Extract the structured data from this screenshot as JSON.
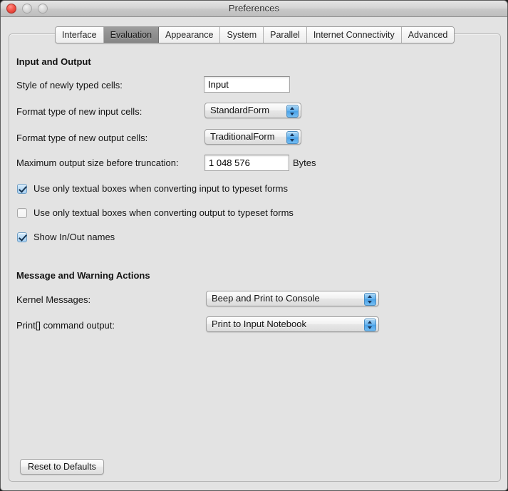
{
  "window": {
    "title": "Preferences",
    "traffic_lights": [
      {
        "name": "close-button",
        "color": "#f4554a"
      },
      {
        "name": "minimize-button",
        "color": "#d8d8d8"
      },
      {
        "name": "zoom-button",
        "color": "#d8d8d8"
      }
    ]
  },
  "tabs": [
    {
      "label": "Interface",
      "selected": false
    },
    {
      "label": "Evaluation",
      "selected": true
    },
    {
      "label": "Appearance",
      "selected": false
    },
    {
      "label": "System",
      "selected": false
    },
    {
      "label": "Parallel",
      "selected": false
    },
    {
      "label": "Internet Connectivity",
      "selected": false
    },
    {
      "label": "Advanced",
      "selected": false
    }
  ],
  "sections": {
    "input_output": {
      "title": "Input and Output",
      "style_of_new_cells": {
        "label": "Style of newly typed cells:",
        "value": "Input",
        "placeholder": ""
      },
      "format_input_cells": {
        "label": "Format type of new input cells:",
        "value": "StandardForm"
      },
      "format_output_cells": {
        "label": "Format type of new output cells:",
        "value": "TraditionalForm"
      },
      "max_output_size": {
        "label": "Maximum output size before truncation:",
        "value": "1 048 576",
        "unit": "Bytes"
      },
      "checkbox_input_textual": {
        "label": "Use only textual boxes when converting input to typeset forms",
        "checked": true
      },
      "checkbox_output_textual": {
        "label": "Use only textual boxes when converting output to typeset forms",
        "checked": false
      },
      "checkbox_inout_names": {
        "label": "Show In/Out names",
        "checked": true
      }
    },
    "messages": {
      "title": "Message and Warning Actions",
      "kernel_messages": {
        "label": "Kernel Messages:",
        "value": "Beep and Print to Console"
      },
      "print_command_output": {
        "label": "Print[] command output:",
        "value": "Print to Input Notebook"
      }
    }
  },
  "footer": {
    "reset_button": "Reset to Defaults"
  }
}
